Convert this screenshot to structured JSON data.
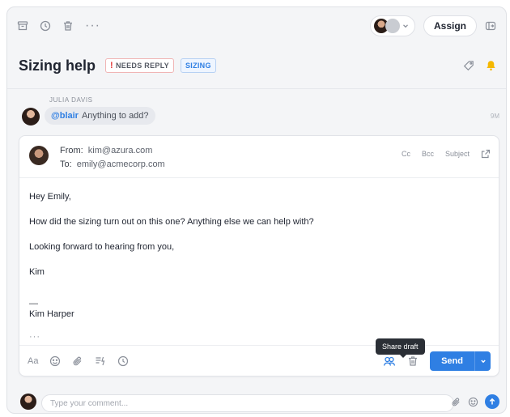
{
  "toolbar": {
    "assign_label": "Assign",
    "more_label": "···"
  },
  "conversation": {
    "subject": "Sizing help",
    "tags": [
      {
        "label": "NEEDS REPLY",
        "color": "#e23b3b"
      },
      {
        "label": "SIZING",
        "color": "#2f7fe3"
      }
    ]
  },
  "comment": {
    "author": "JULIA DAVIS",
    "mention": "@blair",
    "text": "Anything to add?",
    "time": "9M"
  },
  "draft": {
    "from_label": "From:",
    "from": "kim@azura.com",
    "to_label": "To:",
    "to": "emily@acmecorp.com",
    "header_actions": {
      "cc": "Cc",
      "bcc": "Bcc",
      "subject": "Subject"
    },
    "body": [
      "Hey Emily,",
      "How did the sizing turn out on this one? Anything else we can help with?",
      "Looking forward to hearing from you,",
      "Kim"
    ],
    "signature_dash": "—",
    "signature_name": "Kim Harper",
    "ellipsis": "···",
    "format_label": "Aa",
    "send_label": "Send",
    "tooltip": "Share draft"
  },
  "composer": {
    "placeholder": "Type your comment..."
  },
  "colors": {
    "accent": "#2f7fe3",
    "alert": "#e23b3b",
    "bell": "#f5b800"
  }
}
